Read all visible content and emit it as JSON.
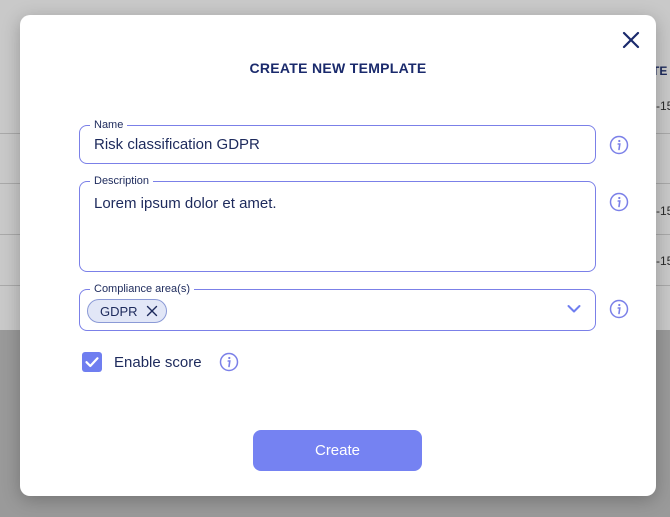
{
  "background": {
    "column_header": "TE",
    "cells": [
      "-15",
      "-15",
      "-15"
    ]
  },
  "modal": {
    "title": "CREATE NEW TEMPLATE",
    "close_icon": "close-icon",
    "name_field": {
      "label": "Name",
      "value": "Risk classification GDPR"
    },
    "description_field": {
      "label": "Description",
      "value": "Lorem ipsum dolor et amet."
    },
    "compliance_field": {
      "label": "Compliance area(s)",
      "chips": [
        "GDPR"
      ]
    },
    "enable_score": {
      "label": "Enable score",
      "checked": true
    },
    "create_button": "Create"
  },
  "colors": {
    "accent": "#7582f2",
    "border": "#7b80e8",
    "text": "#1d2a5c",
    "chip_bg": "#e2e7f7"
  }
}
